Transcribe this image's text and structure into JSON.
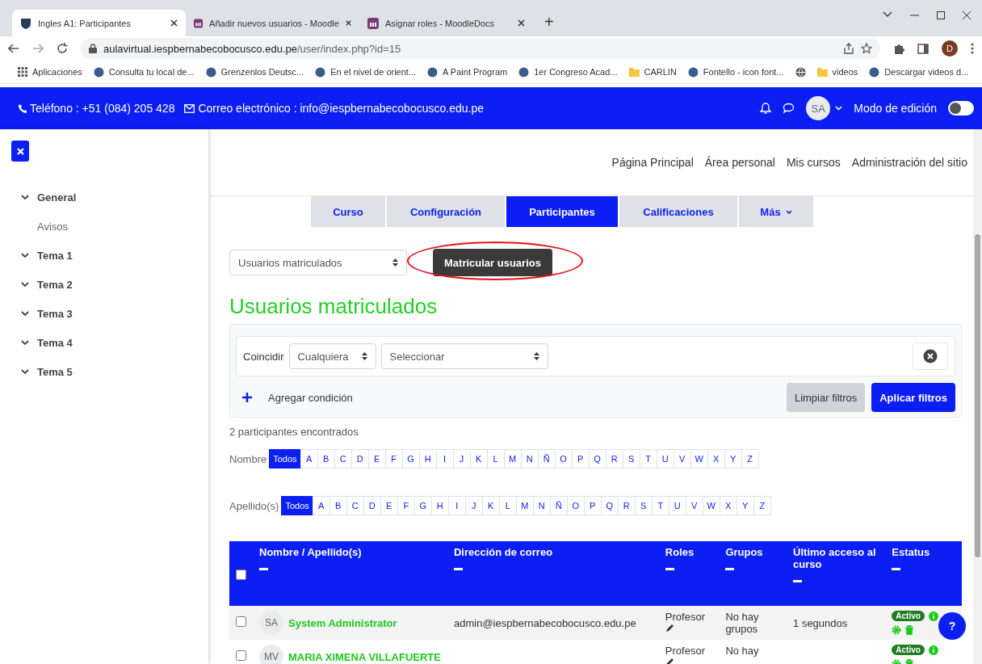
{
  "browser": {
    "tabs": [
      {
        "title": "Ingles A1: Participantes",
        "kind": "course",
        "selected": true
      },
      {
        "title": "Añadir nuevos usuarios - Moodle",
        "kind": "docs",
        "selected": false
      },
      {
        "title": "Asignar roles - MoodleDocs",
        "kind": "docs",
        "selected": false
      }
    ],
    "new_tab": "+",
    "address": {
      "host": "aulavirtual.iespbernabecobocusco.edu.pe",
      "path": "/user/index.php?id=15"
    },
    "profile": "D",
    "bookmarks": [
      {
        "label": "Aplicaciones",
        "kind": "apps"
      },
      {
        "label": "Consulta tu local de...",
        "kind": "site"
      },
      {
        "label": "Grenzenlos Deutsc...",
        "kind": "site"
      },
      {
        "label": "En el nivel de orient...",
        "kind": "site"
      },
      {
        "label": "A Paint Program",
        "kind": "site"
      },
      {
        "label": "1er Congreso Acad...",
        "kind": "site"
      },
      {
        "label": "CARLIN",
        "kind": "folder"
      },
      {
        "label": "Fontello - icon font...",
        "kind": "site"
      },
      {
        "kind": "globe"
      },
      {
        "label": "videos",
        "kind": "folder"
      },
      {
        "label": "Descargar videos d...",
        "kind": "site"
      }
    ]
  },
  "navbar": {
    "phone": "Teléfono : +51 (084) 205 428",
    "email": "Correo electrónico : info@iespbernabecobocusco.edu.pe",
    "avatar": "SA",
    "edit_mode": {
      "label": "Modo de edición",
      "on": false
    }
  },
  "sidebar": {
    "items": [
      {
        "label": "General",
        "expanded": true,
        "children": [
          {
            "label": "Avisos"
          }
        ]
      },
      {
        "label": "Tema 1",
        "expanded": true
      },
      {
        "label": "Tema 2",
        "expanded": true
      },
      {
        "label": "Tema 3",
        "expanded": true
      },
      {
        "label": "Tema 4",
        "expanded": true
      },
      {
        "label": "Tema 5",
        "expanded": true
      }
    ]
  },
  "top_links": [
    "Página Principal",
    "Área personal",
    "Mis cursos",
    "Administración del sitio"
  ],
  "course_tabs": [
    {
      "label": "Curso",
      "kind": "link",
      "selected": false
    },
    {
      "label": "Configuración",
      "kind": "link",
      "selected": false
    },
    {
      "label": "Participantes",
      "kind": "link",
      "selected": true
    },
    {
      "label": "Calificaciones",
      "kind": "link",
      "selected": false
    },
    {
      "label": "Más",
      "kind": "menu",
      "selected": false
    }
  ],
  "page_select": "Usuarios matriculados",
  "enrol_button": {
    "label": "Matricular usuarios",
    "highlighted": true
  },
  "heading": "Usuarios matriculados",
  "filter": {
    "match_label": "Coincidir",
    "match_value": "Cualquiera",
    "condition_placeholder": "Seleccionar",
    "add_condition": "Agregar condición",
    "clear": "Limpiar filtros",
    "apply": "Aplicar filtros"
  },
  "count": "2 participantes encontrados",
  "initials_bars": [
    {
      "label": "Nombre",
      "letters": [
        {
          "label": "Todos",
          "selected": true
        },
        {
          "label": "A",
          "selected": false
        },
        {
          "label": "B",
          "selected": false
        },
        {
          "label": "C",
          "selected": false
        },
        {
          "label": "D",
          "selected": false
        },
        {
          "label": "E",
          "selected": false
        },
        {
          "label": "F",
          "selected": false
        },
        {
          "label": "G",
          "selected": false
        },
        {
          "label": "H",
          "selected": false
        },
        {
          "label": "I",
          "selected": false
        },
        {
          "label": "J",
          "selected": false
        },
        {
          "label": "K",
          "selected": false
        },
        {
          "label": "L",
          "selected": false
        },
        {
          "label": "M",
          "selected": false
        },
        {
          "label": "N",
          "selected": false
        },
        {
          "label": "Ñ",
          "selected": false
        },
        {
          "label": "O",
          "selected": false
        },
        {
          "label": "P",
          "selected": false
        },
        {
          "label": "Q",
          "selected": false
        },
        {
          "label": "R",
          "selected": false
        },
        {
          "label": "S",
          "selected": false
        },
        {
          "label": "T",
          "selected": false
        },
        {
          "label": "U",
          "selected": false
        },
        {
          "label": "V",
          "selected": false
        },
        {
          "label": "W",
          "selected": false
        },
        {
          "label": "X",
          "selected": false
        },
        {
          "label": "Y",
          "selected": false
        },
        {
          "label": "Z",
          "selected": false
        }
      ]
    },
    {
      "label": "Apellido(s)",
      "letters": [
        {
          "label": "Todos",
          "selected": true
        },
        {
          "label": "A",
          "selected": false
        },
        {
          "label": "B",
          "selected": false
        },
        {
          "label": "C",
          "selected": false
        },
        {
          "label": "D",
          "selected": false
        },
        {
          "label": "E",
          "selected": false
        },
        {
          "label": "F",
          "selected": false
        },
        {
          "label": "G",
          "selected": false
        },
        {
          "label": "H",
          "selected": false
        },
        {
          "label": "I",
          "selected": false
        },
        {
          "label": "J",
          "selected": false
        },
        {
          "label": "K",
          "selected": false
        },
        {
          "label": "L",
          "selected": false
        },
        {
          "label": "M",
          "selected": false
        },
        {
          "label": "N",
          "selected": false
        },
        {
          "label": "Ñ",
          "selected": false
        },
        {
          "label": "O",
          "selected": false
        },
        {
          "label": "P",
          "selected": false
        },
        {
          "label": "Q",
          "selected": false
        },
        {
          "label": "R",
          "selected": false
        },
        {
          "label": "S",
          "selected": false
        },
        {
          "label": "T",
          "selected": false
        },
        {
          "label": "U",
          "selected": false
        },
        {
          "label": "V",
          "selected": false
        },
        {
          "label": "W",
          "selected": false
        },
        {
          "label": "X",
          "selected": false
        },
        {
          "label": "Y",
          "selected": false
        },
        {
          "label": "Z",
          "selected": false
        }
      ]
    }
  ],
  "table": {
    "select_all": {
      "checked": false
    },
    "columns": [
      "Nombre / Apellido(s)",
      "Dirección de correo",
      "Roles",
      "Grupos",
      "Último acceso al curso",
      "Estatus"
    ],
    "rows": [
      {
        "checked": false,
        "initials": "SA",
        "name": "System Administrator",
        "email": "admin@iespbernabecobocusco.edu.pe",
        "roles": "Profesor",
        "groups": "No hay grupos",
        "last_access": "1 segundos",
        "status": "Activo"
      },
      {
        "checked": false,
        "initials": "MV",
        "name": "MARIA XIMENA VILLAFUERTE",
        "roles": "Profesor",
        "groups": "No hay",
        "status": "Activo"
      }
    ]
  },
  "help_button": "?"
}
